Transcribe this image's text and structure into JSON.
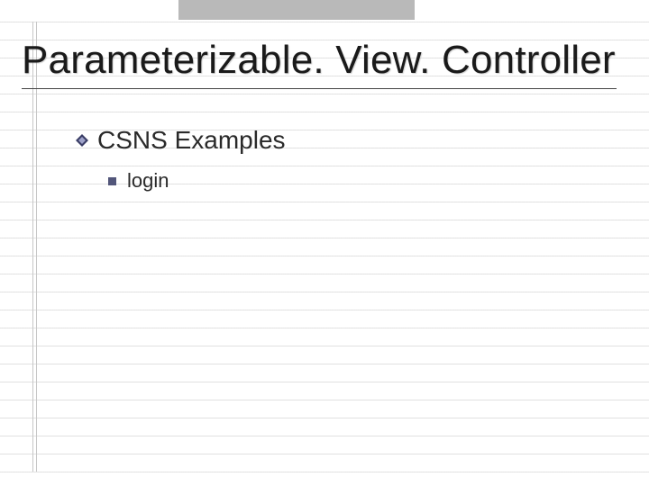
{
  "slide": {
    "title": "Parameterizable. View. Controller",
    "bullets": {
      "level1": {
        "text": "CSNS Examples"
      },
      "level2": {
        "text": "login"
      }
    }
  },
  "colors": {
    "diamond_dark": "#3a3d66",
    "diamond_light": "#9ea2c9",
    "square": "#52567a",
    "topbar": "#b9b9b9"
  }
}
